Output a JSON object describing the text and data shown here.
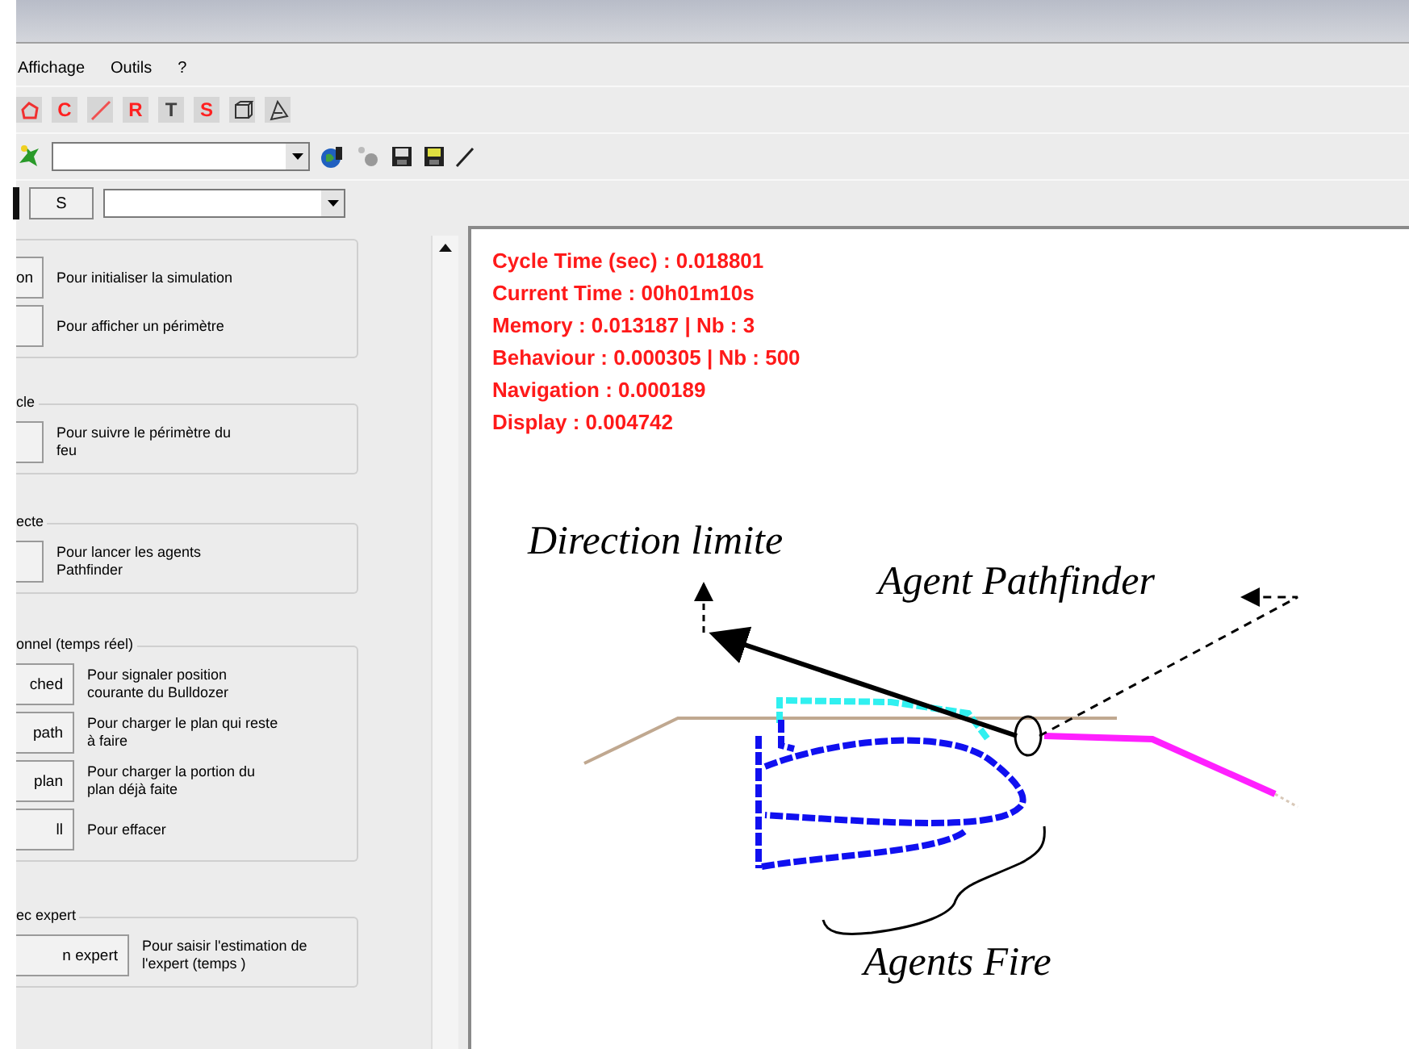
{
  "menu": [
    {
      "label": "Affichage"
    },
    {
      "label": "Outils"
    },
    {
      "label": "?"
    }
  ],
  "toolbar_1": [
    {
      "kind": "polygon"
    },
    {
      "kind": "letter",
      "label": "C",
      "color": "#ff2020"
    },
    {
      "kind": "line"
    },
    {
      "kind": "letter",
      "label": "R",
      "color": "#ff2020"
    },
    {
      "kind": "letter",
      "label": "T",
      "color": "#404040"
    },
    {
      "kind": "letter",
      "label": "S",
      "color": "#ff2020"
    },
    {
      "kind": "cube"
    },
    {
      "kind": "shape"
    }
  ],
  "toolbar_3": {
    "button": "S"
  },
  "panel_groups": [
    {
      "rows": [
        {
          "button": "on",
          "description": "Pour initialiser la simulation"
        },
        {
          "description": "Pour afficher un périmètre"
        }
      ]
    },
    {
      "legend": "cle",
      "rows": [
        {
          "description": "Pour suivre le périmètre du feu"
        }
      ]
    },
    {
      "legend": "ecte",
      "rows": [
        {
          "description": "Pour lancer les agents Pathfinder"
        }
      ]
    },
    {
      "legend": "onnel (temps réel)",
      "rows": [
        {
          "button": "ched",
          "description": "Pour signaler position courante du Bulldozer"
        },
        {
          "button": "path",
          "description": "Pour charger le plan qui reste à faire"
        },
        {
          "button": "plan",
          "description": "Pour charger la portion du plan déjà faite"
        },
        {
          "button": "ll",
          "description": "Pour effacer"
        }
      ]
    },
    {
      "legend": "ec expert",
      "rows": [
        {
          "button": "n expert",
          "description": "Pour saisir l'estimation de l'expert (temps )"
        }
      ]
    }
  ],
  "stats": [
    "Cycle Time (sec) : 0.018801",
    "Current Time : 00h01m10s",
    "Memory : 0.013187 | Nb : 3",
    "Behaviour : 0.000305 | Nb : 500",
    "Navigation : 0.000189",
    "Display : 0.004742"
  ],
  "annotations": {
    "direction": "Direction limite",
    "pathfinder": "Agent Pathfinder",
    "fire": "Agents Fire"
  }
}
